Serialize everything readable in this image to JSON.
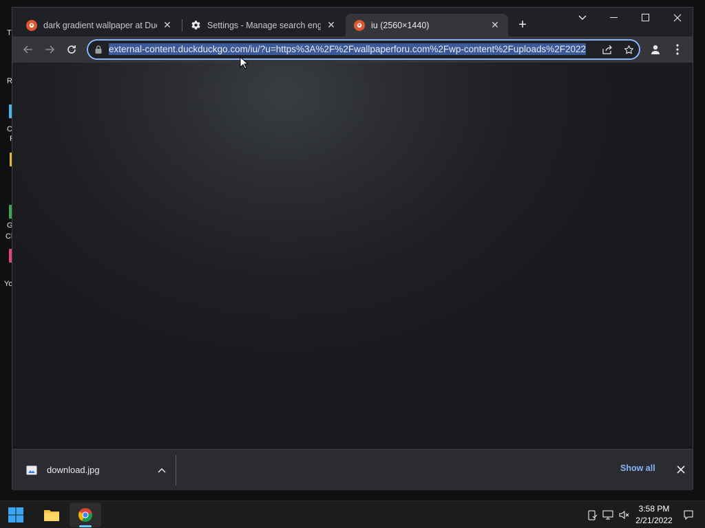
{
  "desktop": {
    "labels": [
      "Th",
      "Re",
      "C",
      "F",
      "G",
      "Cl",
      "Yo"
    ]
  },
  "browser": {
    "tabs": [
      {
        "title": "dark gradient wallpaper at DuckDuckGo",
        "icon": "duckduckgo-icon",
        "active": false
      },
      {
        "title": "Settings - Manage search engines",
        "icon": "gear-icon",
        "active": false
      },
      {
        "title": "iu (2560×1440)",
        "icon": "duckduckgo-icon",
        "active": true
      }
    ],
    "new_tab_label": "+",
    "address": {
      "url": "external-content.duckduckgo.com/iu/?u=https%3A%2F%2Fwallpaperforu.com%2Fwp-content%2Fuploads%2F2022"
    },
    "accent_color": "#8ab4f8"
  },
  "downloads_bar": {
    "file_name": "download.jpg",
    "show_all_label": "Show all"
  },
  "taskbar": {
    "time": "3:58 PM",
    "date": "2/21/2022"
  }
}
